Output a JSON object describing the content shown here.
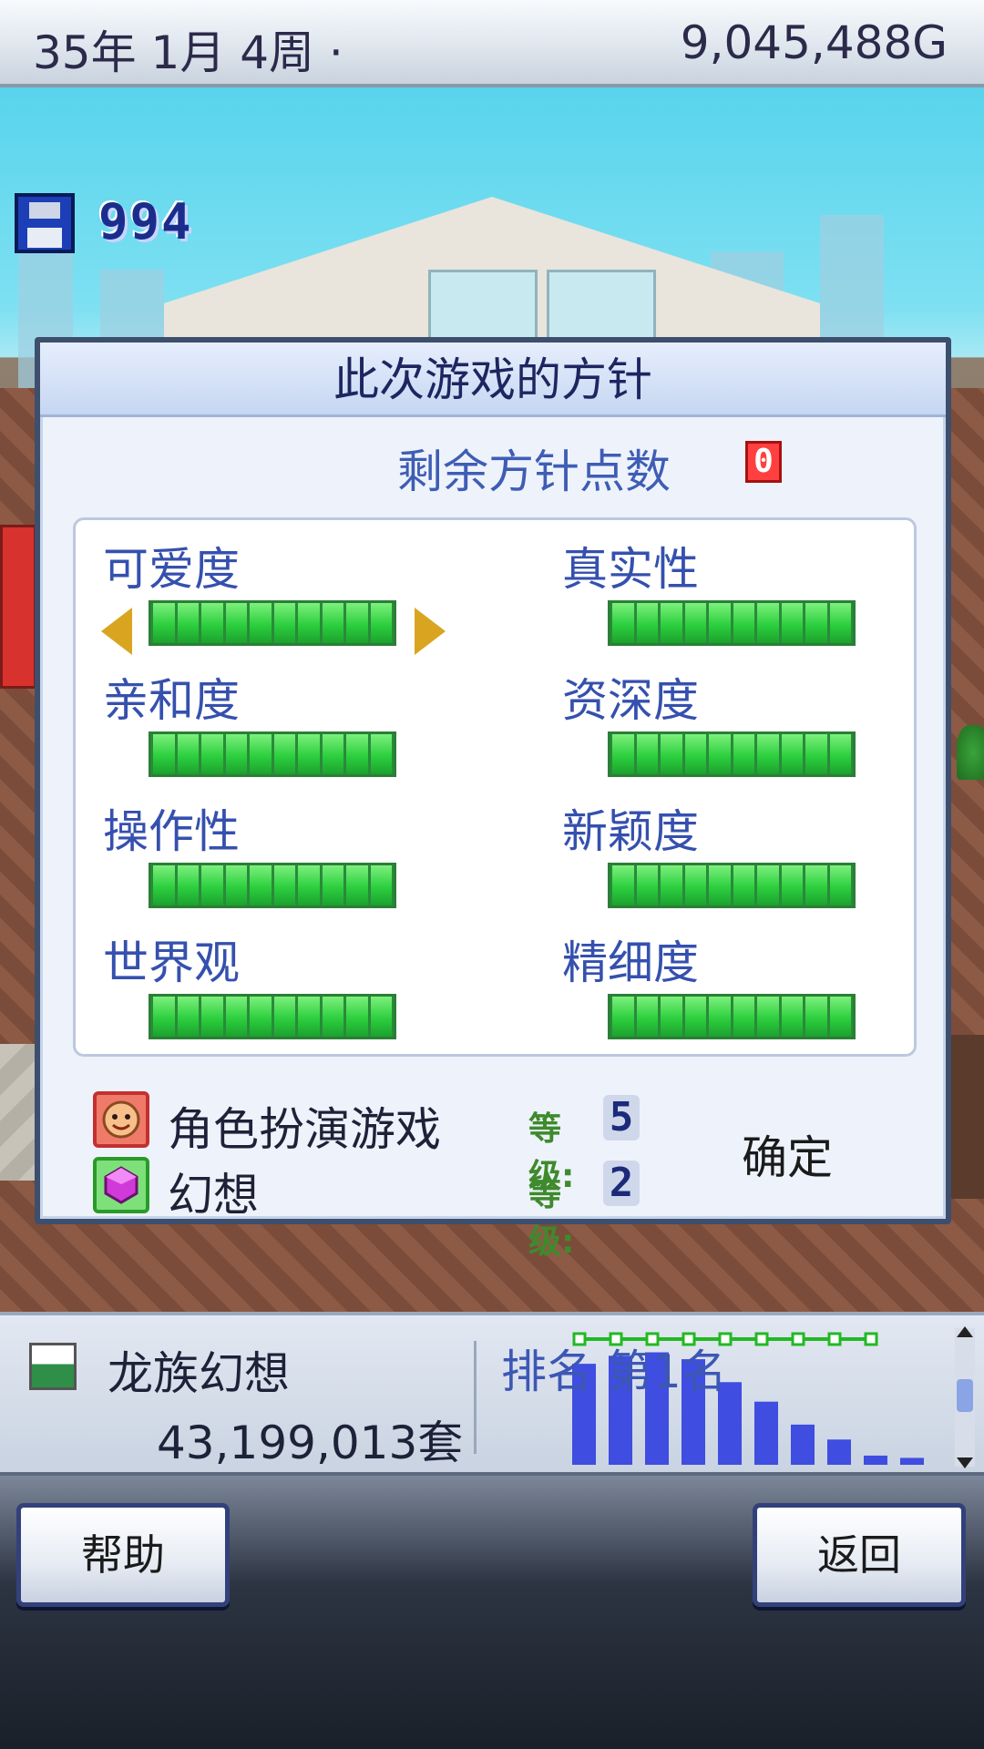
{
  "topbar": {
    "date": "35年 1月 4周 ·",
    "money": "9,045,488G"
  },
  "save": {
    "icon": "floppy-disk-icon",
    "count": "994"
  },
  "dialog": {
    "title": "此次游戏的方针",
    "remaining_label": "剩余方针点数",
    "remaining_value": "0",
    "attributes": [
      {
        "label": "可爱度",
        "level": 1.0,
        "selected": true
      },
      {
        "label": "真实性",
        "level": 1.0
      },
      {
        "label": "亲和度",
        "level": 1.0
      },
      {
        "label": "资深度",
        "level": 1.0
      },
      {
        "label": "操作性",
        "level": 1.0
      },
      {
        "label": "新颖度",
        "level": 1.0
      },
      {
        "label": "世界观",
        "level": 1.0
      },
      {
        "label": "精细度",
        "level": 1.0
      }
    ],
    "genres": [
      {
        "icon": "smiley-face-icon",
        "name": "角色扮演游戏",
        "level_label": "等级:",
        "level": "5"
      },
      {
        "icon": "purple-gem-icon",
        "name": "幻想",
        "level_label": "等级:",
        "level": "2"
      }
    ],
    "confirm_label": "确定"
  },
  "sales": {
    "game_name": "龙族幻想",
    "units": "43,199,013套",
    "rank_label": "排名 第1名"
  },
  "chart_data": {
    "type": "bar",
    "values": [
      88,
      95,
      98,
      92,
      72,
      55,
      35,
      22,
      8,
      6
    ],
    "overlay_line": [
      1,
      1,
      1,
      1,
      1,
      1,
      1,
      1,
      1
    ],
    "colors": {
      "bar": "#3f4de0",
      "line": "#23b823"
    }
  },
  "nav": {
    "help_label": "帮助",
    "back_label": "返回"
  },
  "colors": {
    "accent": "#3550ae",
    "bar_green": "#2ccf3e",
    "title": "#1e2560"
  }
}
